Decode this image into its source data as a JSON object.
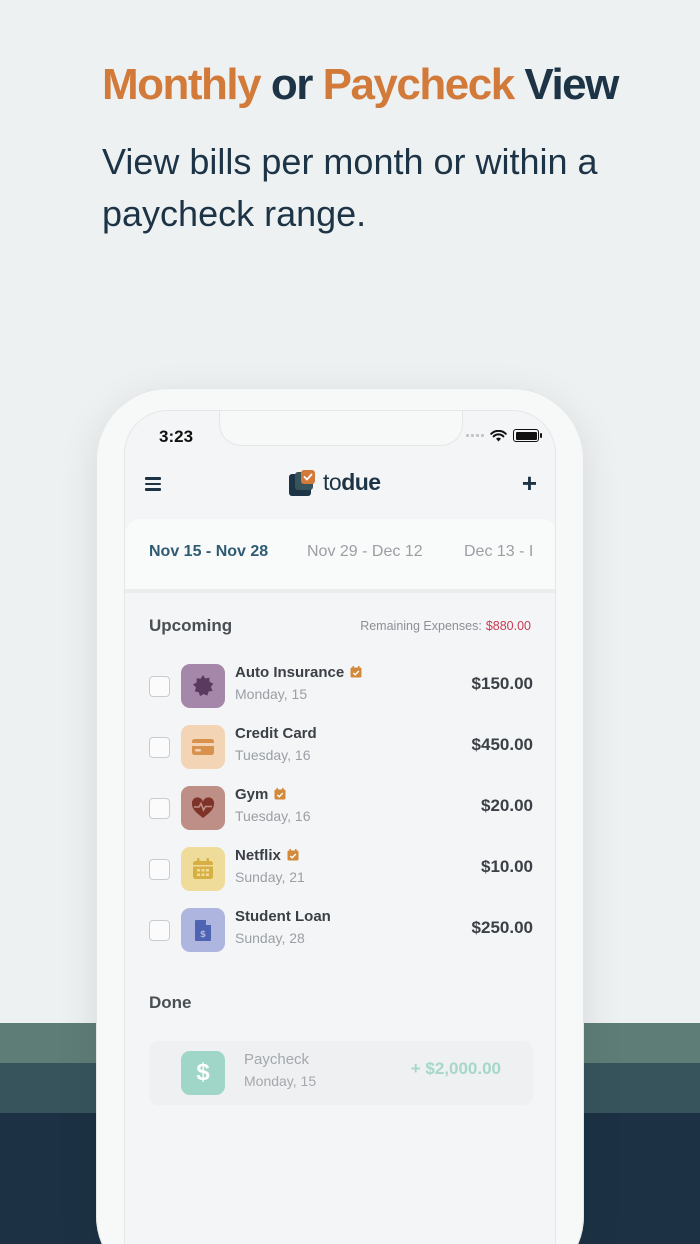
{
  "headline": {
    "word1": "Monthly",
    "word2": "or",
    "word3": "Paycheck",
    "word4": "View"
  },
  "subtitle": "View bills per month or within a paycheck range.",
  "colors": {
    "orange": "#d27a3a",
    "navy": "#1d3446",
    "negative": "#c73a56",
    "income": "#a6d7c9"
  },
  "status": {
    "time": "3:23"
  },
  "app": {
    "logo_to": "to",
    "logo_due": "due",
    "menu_icon": "hamburger-icon",
    "add_icon": "plus-icon"
  },
  "tabs": [
    {
      "label": "Nov 15 - Nov 28"
    },
    {
      "label": "Nov 29 - Dec 12"
    },
    {
      "label": "Dec 13 - I"
    }
  ],
  "upcoming": {
    "title": "Upcoming",
    "remaining_label": "Remaining Expenses:",
    "remaining_amount": "$880.00",
    "bills": [
      {
        "name": "Auto Insurance",
        "date": "Monday, 15",
        "amount": "$150.00",
        "icon": "badge-icon",
        "autopay": true
      },
      {
        "name": "Credit Card",
        "date": "Tuesday, 16",
        "amount": "$450.00",
        "icon": "credit-card-icon",
        "autopay": false
      },
      {
        "name": "Gym",
        "date": "Tuesday, 16",
        "amount": "$20.00",
        "icon": "heart-pulse-icon",
        "autopay": true
      },
      {
        "name": "Netflix",
        "date": "Sunday, 21",
        "amount": "$10.00",
        "icon": "calendar-icon",
        "autopay": true
      },
      {
        "name": "Student Loan",
        "date": "Sunday, 28",
        "amount": "$250.00",
        "icon": "document-dollar-icon",
        "autopay": false
      }
    ]
  },
  "done": {
    "title": "Done",
    "item": {
      "name": "Paycheck",
      "date": "Monday, 15",
      "amount": "+ $2,000.00",
      "icon_glyph": "$"
    }
  }
}
